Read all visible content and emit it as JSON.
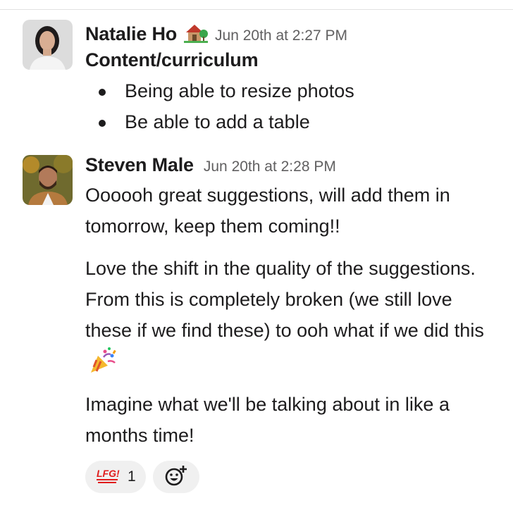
{
  "messages": [
    {
      "sender": "Natalie Ho",
      "status_icon": "house-with-garden-icon",
      "timestamp": "Jun 20th at 2:27 PM",
      "heading": "Content/curriculum",
      "bullets": [
        "Being able to resize photos",
        "Be able to add a table"
      ]
    },
    {
      "sender": "Steven Male",
      "timestamp": "Jun 20th at 2:28 PM",
      "paragraphs": [
        "Oooooh great suggestions, will add them in tomorrow, keep them coming!!",
        "Love the shift in the quality of the suggestions. From this is completely broken (we still love these if we find these) to ooh what if we did this",
        "Imagine what we'll be talking about in like a months time!"
      ],
      "inline_icon": "party-popper-icon",
      "reactions": [
        {
          "emoji_text": "LFG!",
          "count": "1",
          "icon": "lfg-emoji-icon"
        }
      ],
      "add_reaction_icon": "add-reaction-icon"
    }
  ],
  "colors": {
    "text": "#1d1c1d",
    "muted": "#616061",
    "reaction_bg": "#f0f0f0",
    "lfg_red": "#e01e1e"
  }
}
